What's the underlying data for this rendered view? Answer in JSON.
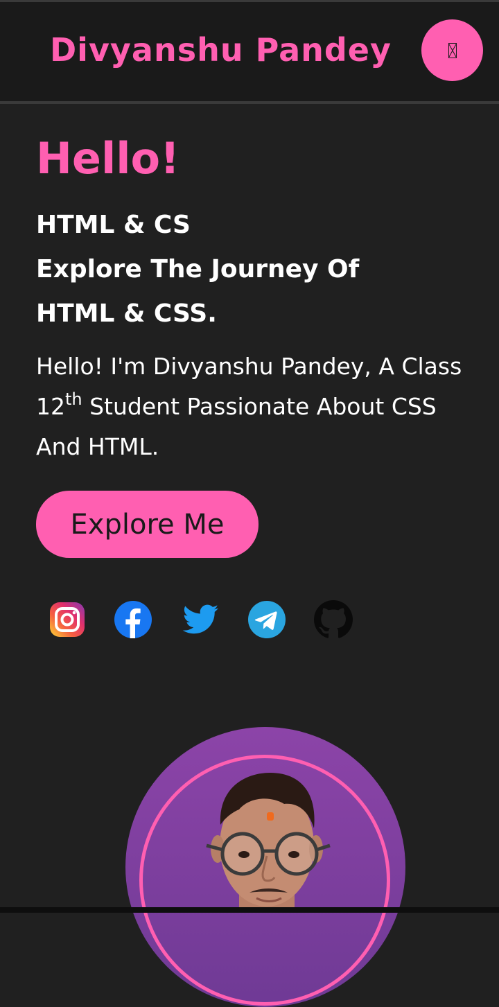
{
  "header": {
    "title": "Divyanshu Pandey",
    "menu_icon": "menu-icon"
  },
  "hero": {
    "greeting": "Hello!",
    "subtitle_lines": [
      "HTML & CS",
      "Explore The Journey Of",
      "HTML & CSS."
    ],
    "intro_part1": "Hello! I'm Divyanshu Pandey, A Class 12",
    "intro_sup": "th",
    "intro_part2": " Student Passionate About CSS And HTML.",
    "cta_label": "Explore Me"
  },
  "social_links": [
    {
      "name": "instagram-icon"
    },
    {
      "name": "facebook-icon"
    },
    {
      "name": "twitter-icon"
    },
    {
      "name": "telegram-icon"
    },
    {
      "name": "github-icon"
    }
  ],
  "colors": {
    "accent": "#ff5fb1",
    "background": "#202020",
    "header_background": "#1a1a1a",
    "avatar_background": "#8c44a8"
  }
}
